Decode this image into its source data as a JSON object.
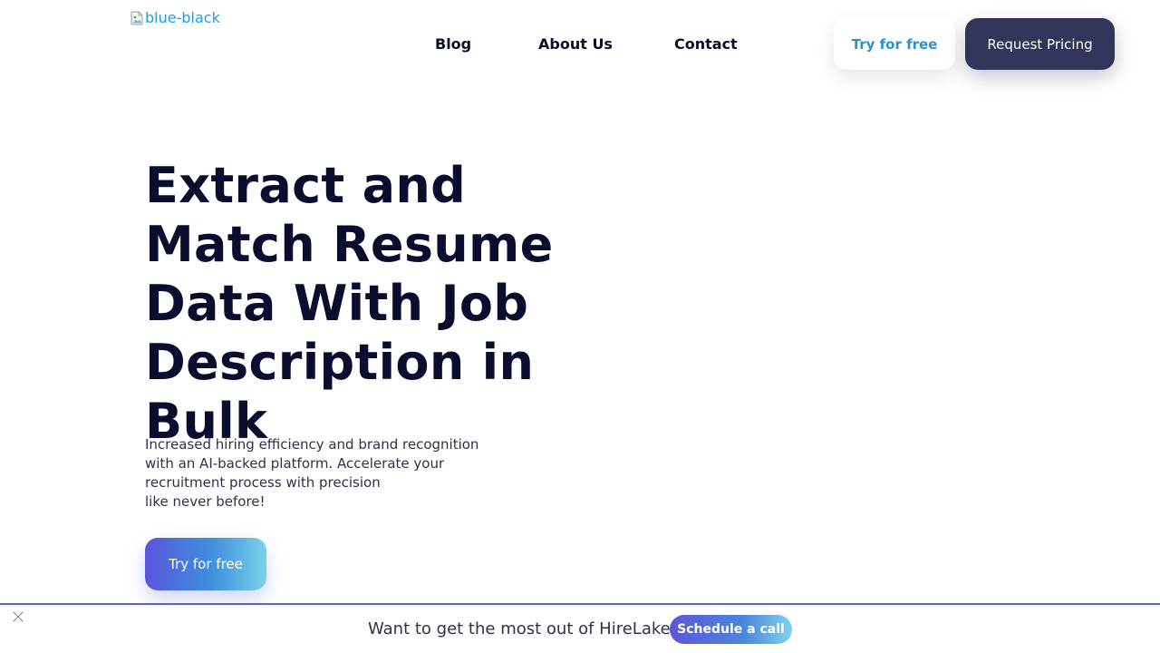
{
  "header": {
    "logo_alt": "blue-black",
    "nav": {
      "blog": "Blog",
      "about": "About Us",
      "contact": "Contact"
    },
    "try_free_label": "Try for free",
    "request_pricing_label": "Request Pricing"
  },
  "hero": {
    "title": "Extract and Match Resume Data With Job Description in Bulk",
    "subtitle": "Increased hiring efficiency and brand recognition\nwith an AI-backed platform. Accelerate your\nrecruitment process with precision\nlike never before!",
    "cta_label": "Try for free"
  },
  "banner": {
    "text": "Want to get the most out of HireLakeAI?",
    "cta_label": "Schedule a call"
  },
  "colors": {
    "navy": "#0b0d2e",
    "pricing_button": "#32345a",
    "try_free_text": "#2d8fd0",
    "banner_border": "#5c5fd4"
  },
  "icons": {
    "logo": "broken-image-icon",
    "banner_close": "close-icon"
  }
}
